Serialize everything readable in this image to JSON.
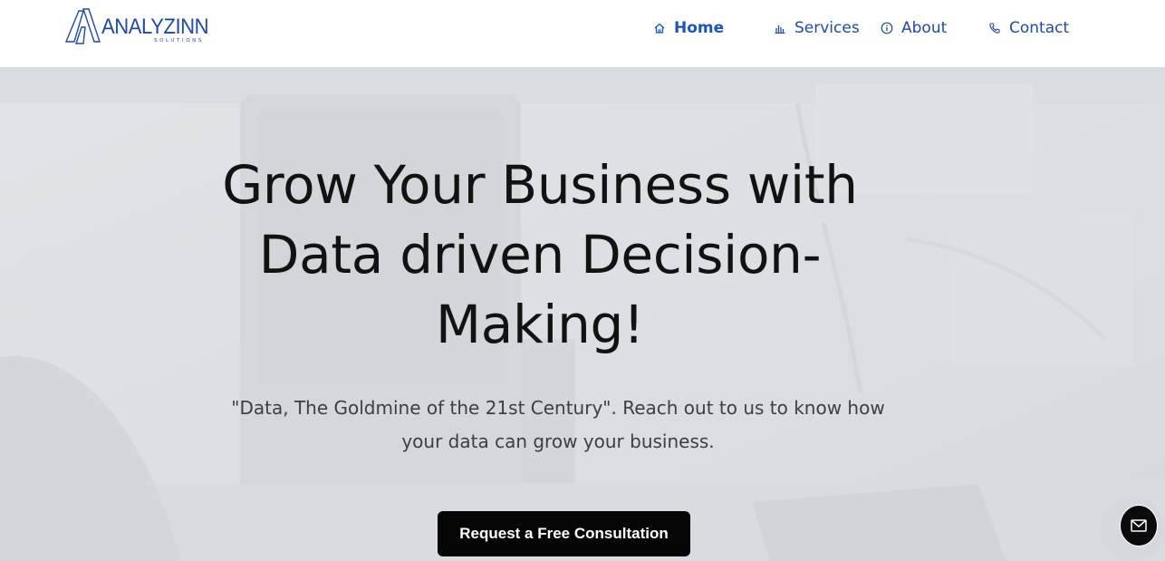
{
  "brand": {
    "name": "ANALYZINN",
    "tagline": "SOLUTIONS",
    "color": "#1f4aa8"
  },
  "nav": {
    "items": [
      {
        "label": "Home",
        "icon": "home-icon",
        "active": true
      },
      {
        "label": "Services",
        "icon": "bar-chart-icon",
        "active": false
      },
      {
        "label": "About",
        "icon": "info-icon",
        "active": false
      },
      {
        "label": "Contact",
        "icon": "phone-icon",
        "active": false
      }
    ]
  },
  "hero": {
    "title": "Grow Your Business with Data driven Decision-Making!",
    "subtitle": "\"Data, The Goldmine of the 21st Century\". Reach out to us to know how your data can grow your business.",
    "cta_label": "Request a Free Consultation"
  },
  "floating": {
    "mail_icon": "mail-icon"
  },
  "colors": {
    "nav_text": "#1f4aa8",
    "cta_bg": "#050505",
    "title_text": "#121212"
  }
}
